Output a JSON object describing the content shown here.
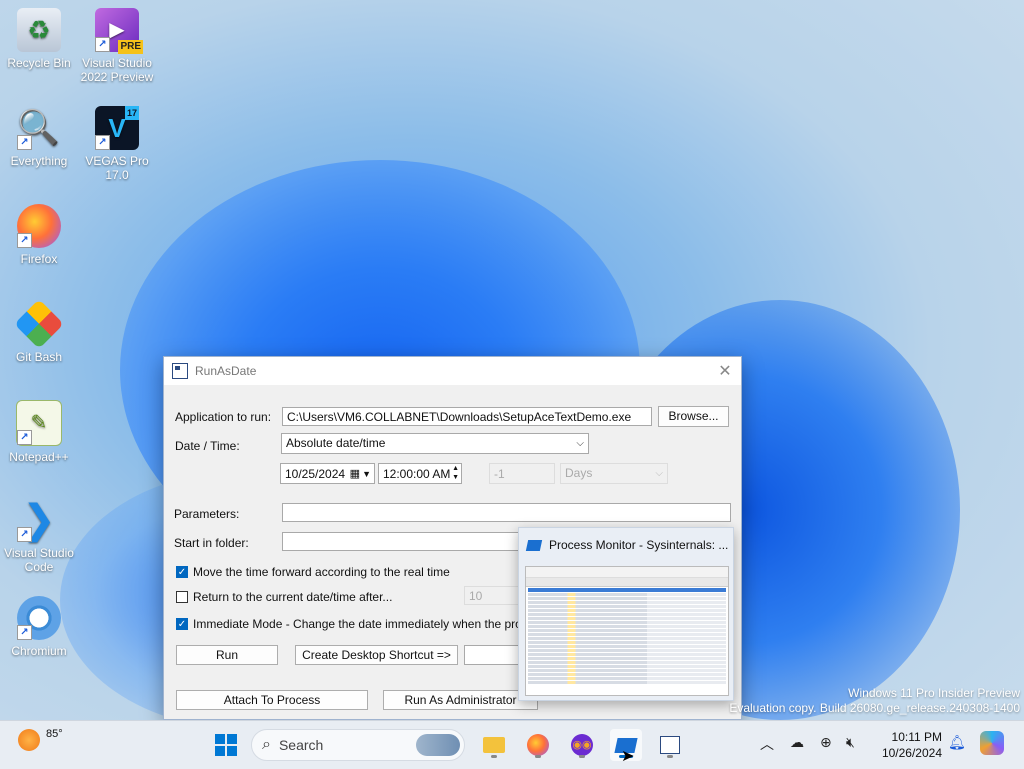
{
  "desktop": {
    "icons": [
      {
        "label": "Recycle Bin"
      },
      {
        "label": "Visual Studio 2022 Preview",
        "badge": "PRE"
      },
      {
        "label": "Everything"
      },
      {
        "label": "VEGAS Pro 17.0",
        "glyph": "V",
        "badge": "17"
      },
      {
        "label": "Firefox"
      },
      {
        "label": "Git Bash"
      },
      {
        "label": "Notepad++"
      },
      {
        "label": "Visual Studio Code"
      },
      {
        "label": "Chromium"
      }
    ],
    "watermark": {
      "line1": "Windows 11 Pro Insider Preview",
      "line2": "Evaluation copy. Build 26080.ge_release.240308-1400"
    }
  },
  "window": {
    "title": "RunAsDate",
    "app_label": "Application to run:",
    "app_value": "C:\\Users\\VM6.COLLABNET\\Downloads\\SetupAceTextDemo.exe",
    "browse_label": "Browse...",
    "datetime_label": "Date / Time:",
    "datetime_mode": "Absolute date/time",
    "date_value": "10/25/2024",
    "time_value": "12:00:00 AM",
    "offset_value": "-1",
    "offset_unit": "Days",
    "parameters_label": "Parameters:",
    "start_folder_label": "Start in folder:",
    "chk_move_forward": "Move the time forward according to the real time",
    "chk_return": "Return to the current date/time after...",
    "return_value": "10",
    "chk_immediate": "Immediate Mode - Change the date immediately when the program s",
    "run_label": "Run",
    "shortcut_label": "Create Desktop Shortcut =>",
    "attach_label": "Attach To Process",
    "run_admin_label": "Run As Administrator"
  },
  "thumbnail": {
    "title": "Process Monitor - Sysinternals: ..."
  },
  "taskbar": {
    "weather_temp": "85°",
    "search_placeholder": "Search",
    "time": "10:11 PM",
    "date": "10/26/2024"
  },
  "colors": {
    "accent": "#0067c0"
  }
}
